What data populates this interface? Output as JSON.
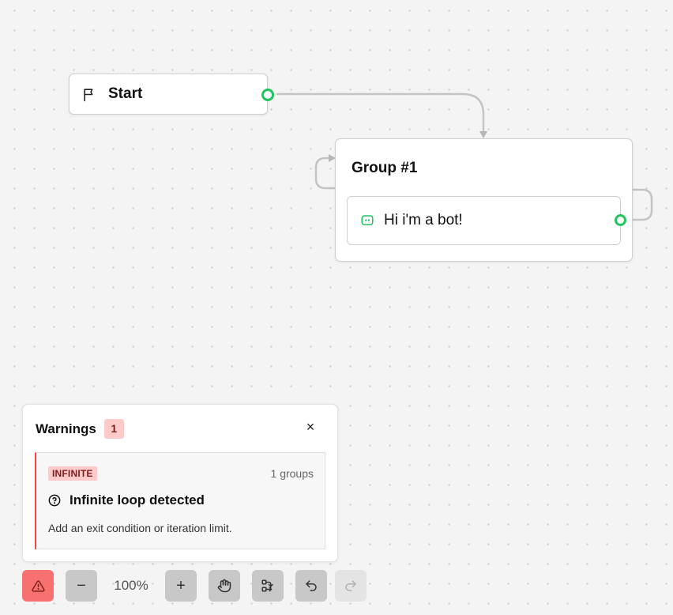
{
  "start_node": {
    "label": "Start",
    "icon": "flag-icon"
  },
  "group_node": {
    "title": "Group #1",
    "block": {
      "text": "Hi i'm a bot!",
      "icon": "chat-bubble-icon"
    }
  },
  "warnings_panel": {
    "title": "Warnings",
    "count": "1",
    "close_label": "×",
    "items": [
      {
        "type": "INFINITE",
        "groups": "1 groups",
        "message": "Infinite loop detected",
        "hint": "Add an exit condition or iteration limit.",
        "icon": "question-circle-icon"
      }
    ]
  },
  "toolbar": {
    "zoom_out_label": "−",
    "zoom_level": "100%",
    "zoom_in_label": "+",
    "icons": [
      "warning-triangle-icon",
      "hand-icon",
      "auto-layout-icon",
      "undo-icon",
      "redo-icon"
    ]
  },
  "colors": {
    "port": "#22c55e",
    "badge_bg": "#fecaca",
    "warning_accent": "#ef4444",
    "warn_button": "#f87171"
  }
}
